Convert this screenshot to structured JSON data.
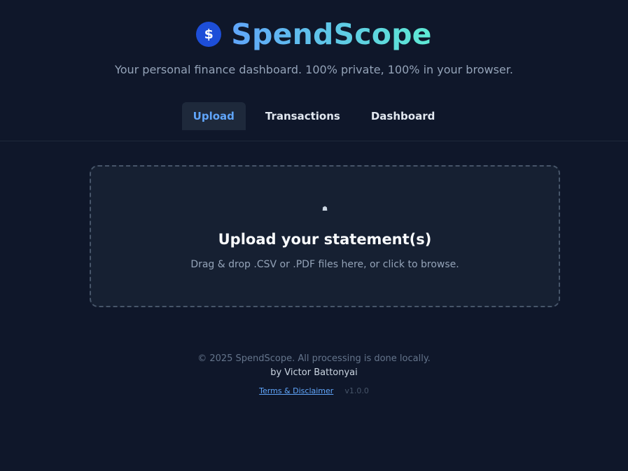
{
  "brand": {
    "logo_symbol": "$",
    "title": "SpendScope",
    "tagline": "Your personal finance dashboard. 100% private, 100% in your browser."
  },
  "tabs": [
    {
      "label": "Upload",
      "active": true
    },
    {
      "label": "Transactions",
      "active": false
    },
    {
      "label": "Dashboard",
      "active": false
    }
  ],
  "upload": {
    "icon": "upload-icon",
    "icon_glyph": "☗",
    "title": "Upload your statement(s)",
    "subtitle": "Drag & drop .CSV or .PDF files here, or click to browse."
  },
  "footer": {
    "copyright": "© 2025 SpendScope. All processing is done locally.",
    "author": "by Victor Battonyai",
    "terms_label": "Terms & Disclaimer",
    "version": "v1.0.0"
  },
  "colors": {
    "background": "#0f172a",
    "accent": "#60a5fa",
    "accent_gradient_end": "#5eead4",
    "logo_bg": "#1d4ed8"
  }
}
